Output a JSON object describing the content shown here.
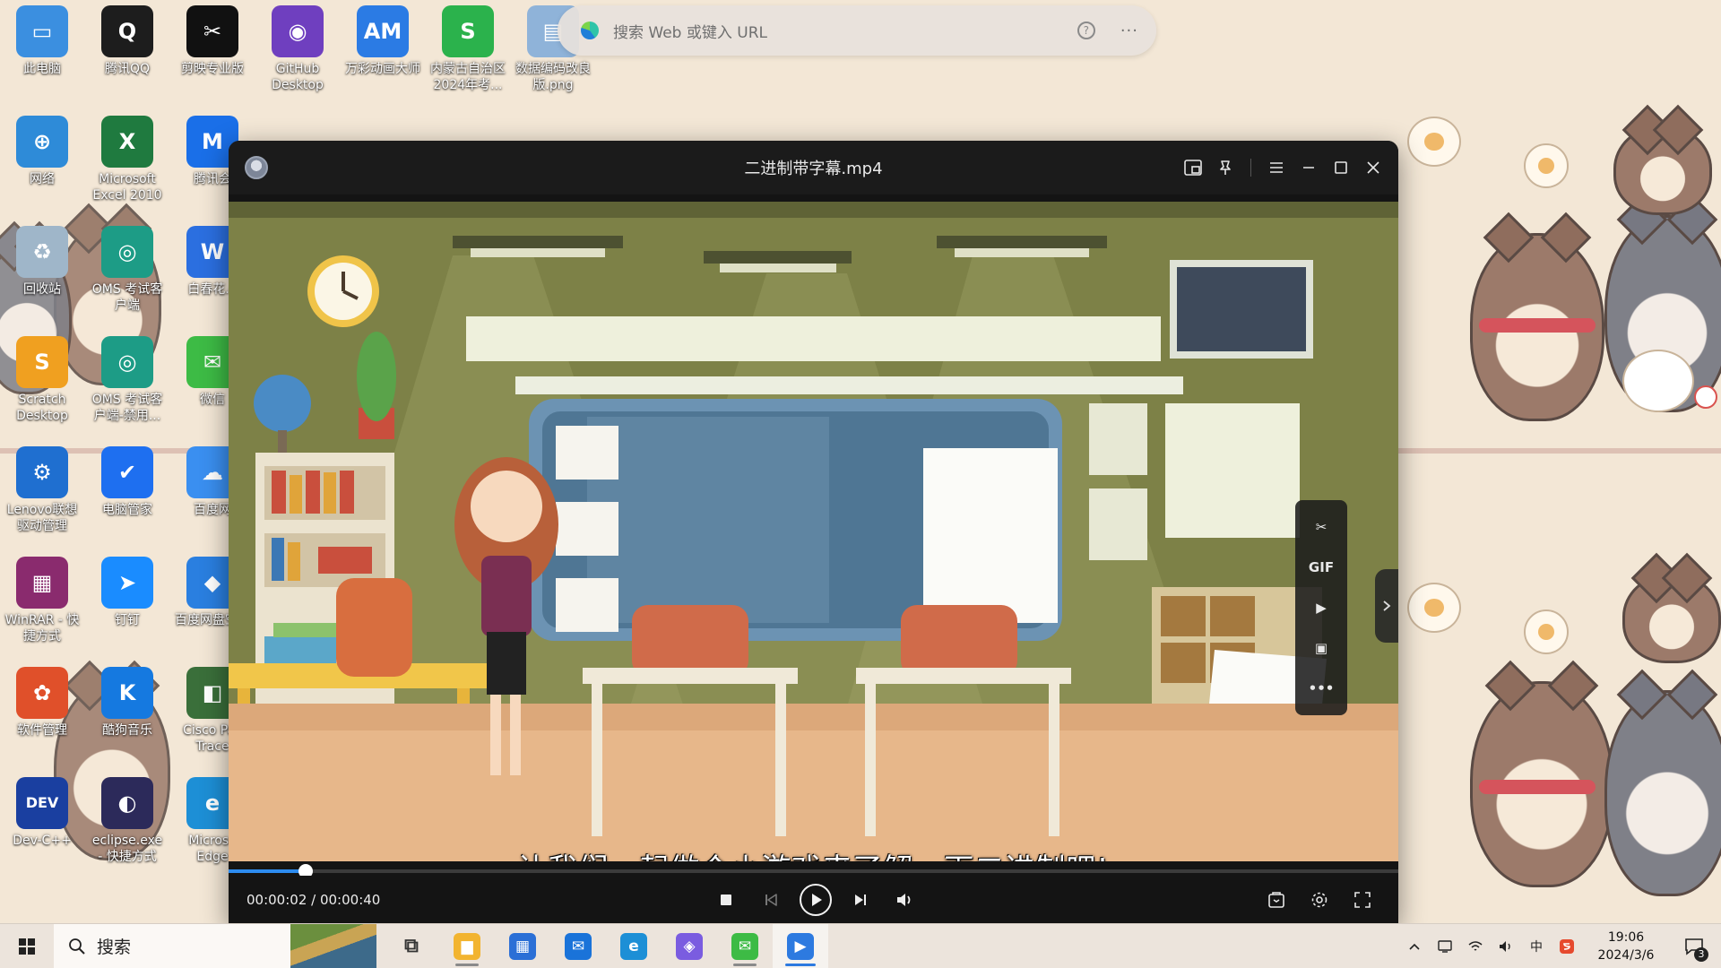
{
  "edge_search": {
    "placeholder": "搜索 Web 或键入 URL",
    "help": "?",
    "more": "···"
  },
  "desktop_icons": [
    {
      "label": "此电脑",
      "color": "#3b8fe0",
      "glyph": "▭"
    },
    {
      "label": "腾讯QQ",
      "color": "#1d1d1d",
      "glyph": "Q"
    },
    {
      "label": "剪映专业版",
      "color": "#111111",
      "glyph": "✂"
    },
    {
      "label": "GitHub Desktop",
      "color": "#6f3fbf",
      "glyph": "◉"
    },
    {
      "label": "万彩动画大师",
      "color": "#2b7be4",
      "glyph": "AM"
    },
    {
      "label": "内蒙古自治区2024年考...",
      "color": "#2bb24c",
      "glyph": "S"
    },
    {
      "label": "数据编码改良版.png",
      "color": "#8fb3d9",
      "glyph": "▤"
    },
    {
      "label": "网络",
      "color": "#2e8bd8",
      "glyph": "⊕"
    },
    {
      "label": "Microsoft Excel 2010",
      "color": "#1f7a3f",
      "glyph": "X"
    },
    {
      "label": "腾讯会",
      "color": "#1a6fe8",
      "glyph": "M"
    },
    {
      "label": "回收站",
      "color": "#9fb6c9",
      "glyph": "♻"
    },
    {
      "label": "OMS 考试客户端",
      "color": "#1d9c86",
      "glyph": "◎"
    },
    {
      "label": "白春花.d",
      "color": "#2b6fe0",
      "glyph": "W"
    },
    {
      "label": "Scratch Desktop",
      "color": "#f0a020",
      "glyph": "S"
    },
    {
      "label": "OMS 考试客户端-禁用...",
      "color": "#1d9c86",
      "glyph": "◎"
    },
    {
      "label": "微信",
      "color": "#3dbb45",
      "glyph": "✉"
    },
    {
      "label": "Lenovo联想驱动管理",
      "color": "#1f6fd0",
      "glyph": "⚙"
    },
    {
      "label": "电脑管家",
      "color": "#1e6ff0",
      "glyph": "✔"
    },
    {
      "label": "百度网",
      "color": "#3a8ff0",
      "glyph": "☁"
    },
    {
      "label": "WinRAR - 快捷方式",
      "color": "#8a2b6e",
      "glyph": "▦"
    },
    {
      "label": "钉钉",
      "color": "#1a8cff",
      "glyph": "➤"
    },
    {
      "label": "百度网盘空间",
      "color": "#2a7fe0",
      "glyph": "◆"
    },
    {
      "label": "软件管理",
      "color": "#e0502a",
      "glyph": "✿"
    },
    {
      "label": "酷狗音乐",
      "color": "#1579e0",
      "glyph": "K"
    },
    {
      "label": "Cisco Pac Trace",
      "color": "#3a6f3a",
      "glyph": "◧"
    },
    {
      "label": "Dev-C++",
      "color": "#1a3fa0",
      "glyph": "DEV"
    },
    {
      "label": "eclipse.exe - 快捷方式",
      "color": "#2c2a5a",
      "glyph": "◐"
    },
    {
      "label": "Microso Edge",
      "color": "#1d8fd6",
      "glyph": "e"
    }
  ],
  "player": {
    "title": "二进制带字幕.mp4",
    "subtitle": "让我们一起做个小游戏来了解一下二进制吧!",
    "current_time": "00:00:02",
    "total_time": "00:00:40",
    "time_separator": " / ",
    "progress": 0.066,
    "side_tools": [
      {
        "name": "cut-icon",
        "glyph": "✂"
      },
      {
        "name": "gif-button",
        "glyph": "GIF"
      },
      {
        "name": "screen-record-icon",
        "glyph": "▶"
      },
      {
        "name": "screenshot-icon",
        "glyph": "▣"
      },
      {
        "name": "more-tools-icon",
        "glyph": "•••"
      }
    ],
    "accent_color": "#2d8cf0"
  },
  "taskbar": {
    "search_label": "搜索",
    "time": "19:06",
    "date": "2024/3/6",
    "notification_count": "3",
    "input_method": "中",
    "apps": [
      {
        "name": "task-view",
        "glyph": "⧉",
        "color": "#333333",
        "running": false
      },
      {
        "name": "file-explorer",
        "glyph": "▆",
        "color": "#f2b430",
        "running": true
      },
      {
        "name": "microsoft-store",
        "glyph": "▦",
        "color": "#2b6fd6",
        "running": false
      },
      {
        "name": "mail",
        "glyph": "✉",
        "color": "#1a73d9",
        "running": false
      },
      {
        "name": "edge",
        "glyph": "e",
        "color": "#1d8fd6",
        "running": false
      },
      {
        "name": "copilot",
        "glyph": "◈",
        "color": "#7a5ce0",
        "running": false
      },
      {
        "name": "wechat",
        "glyph": "✉",
        "color": "#3dbb45",
        "running": true
      },
      {
        "name": "video-player",
        "glyph": "▶",
        "color": "#2d7ae0",
        "running": true,
        "active": true
      }
    ]
  }
}
